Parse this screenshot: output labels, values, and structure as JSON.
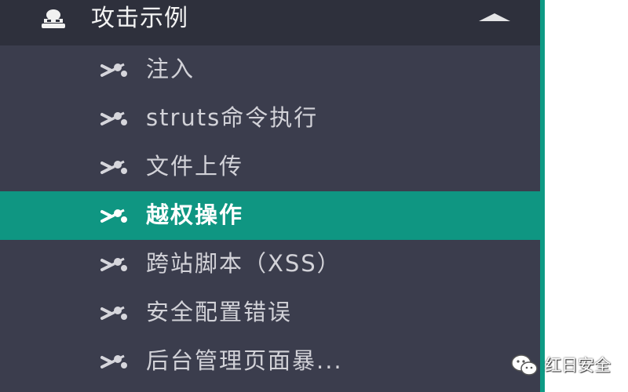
{
  "menu": {
    "header": {
      "title": "攻击示例",
      "icon": "hat-icon",
      "expand_indicator": "caret-up-icon"
    },
    "items": [
      {
        "label": "注入",
        "icon": "bug-scissors-icon",
        "active": false
      },
      {
        "label": "struts命令执行",
        "icon": "bug-scissors-icon",
        "active": false
      },
      {
        "label": "文件上传",
        "icon": "bug-scissors-icon",
        "active": false
      },
      {
        "label": "越权操作",
        "icon": "bug-scissors-icon",
        "active": true
      },
      {
        "label": "跨站脚本（XSS）",
        "icon": "bug-scissors-icon",
        "active": false
      },
      {
        "label": "安全配置错误",
        "icon": "bug-scissors-icon",
        "active": false
      },
      {
        "label": "后台管理页面暴...",
        "icon": "bug-scissors-icon",
        "active": false
      }
    ]
  },
  "watermark": {
    "text": "红日安全",
    "icon": "wechat-icon"
  },
  "colors": {
    "sidebar_bg": "#3b3d4d",
    "header_bg": "#2e303c",
    "active_bg": "#0f9682",
    "accent": "#0e9a84",
    "text": "#d2d2d8"
  }
}
